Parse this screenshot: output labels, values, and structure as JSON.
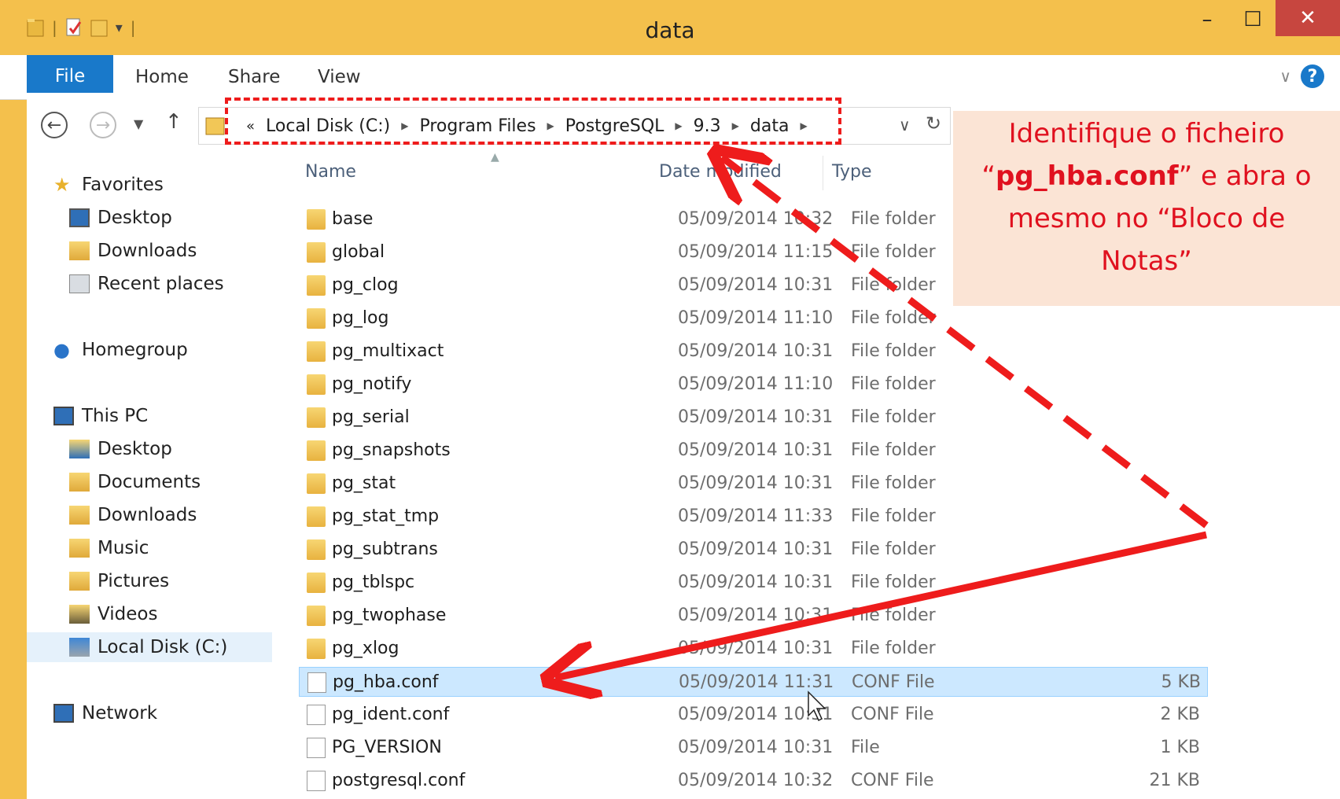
{
  "window": {
    "title": "data",
    "minimize": "–",
    "maximize": "☐",
    "close": "✕"
  },
  "ribbon": {
    "tabs": [
      "File",
      "Home",
      "Share",
      "View"
    ],
    "help": "?"
  },
  "address": {
    "overflow": "«",
    "crumbs": [
      "Local Disk (C:)",
      "Program Files",
      "PostgreSQL",
      "9.3",
      "data"
    ],
    "dropdown": "∨"
  },
  "sidebar": {
    "favorites": "Favorites",
    "fav_items": [
      "Desktop",
      "Downloads",
      "Recent places"
    ],
    "homegroup": "Homegroup",
    "thispc": "This PC",
    "pc_items": [
      "Desktop",
      "Documents",
      "Downloads",
      "Music",
      "Pictures",
      "Videos",
      "Local Disk (C:)"
    ],
    "network": "Network"
  },
  "columns": {
    "name": "Name",
    "date": "Date modified",
    "type": "Type"
  },
  "files": [
    {
      "name": "base",
      "date": "05/09/2014 10:32",
      "type": "File folder",
      "size": "",
      "icon": "folder-icon"
    },
    {
      "name": "global",
      "date": "05/09/2014 11:15",
      "type": "File folder",
      "size": "",
      "icon": "folder-icon"
    },
    {
      "name": "pg_clog",
      "date": "05/09/2014 10:31",
      "type": "File folder",
      "size": "",
      "icon": "folder-icon"
    },
    {
      "name": "pg_log",
      "date": "05/09/2014 11:10",
      "type": "File folder",
      "size": "",
      "icon": "folder-icon"
    },
    {
      "name": "pg_multixact",
      "date": "05/09/2014 10:31",
      "type": "File folder",
      "size": "",
      "icon": "folder-icon"
    },
    {
      "name": "pg_notify",
      "date": "05/09/2014 11:10",
      "type": "File folder",
      "size": "",
      "icon": "folder-icon"
    },
    {
      "name": "pg_serial",
      "date": "05/09/2014 10:31",
      "type": "File folder",
      "size": "",
      "icon": "folder-icon"
    },
    {
      "name": "pg_snapshots",
      "date": "05/09/2014 10:31",
      "type": "File folder",
      "size": "",
      "icon": "folder-icon"
    },
    {
      "name": "pg_stat",
      "date": "05/09/2014 10:31",
      "type": "File folder",
      "size": "",
      "icon": "folder-icon"
    },
    {
      "name": "pg_stat_tmp",
      "date": "05/09/2014 11:33",
      "type": "File folder",
      "size": "",
      "icon": "folder-icon"
    },
    {
      "name": "pg_subtrans",
      "date": "05/09/2014 10:31",
      "type": "File folder",
      "size": "",
      "icon": "folder-icon"
    },
    {
      "name": "pg_tblspc",
      "date": "05/09/2014 10:31",
      "type": "File folder",
      "size": "",
      "icon": "folder-icon"
    },
    {
      "name": "pg_twophase",
      "date": "05/09/2014 10:31",
      "type": "File folder",
      "size": "",
      "icon": "folder-icon"
    },
    {
      "name": "pg_xlog",
      "date": "05/09/2014 10:31",
      "type": "File folder",
      "size": "",
      "icon": "folder-icon"
    },
    {
      "name": "pg_hba.conf",
      "date": "05/09/2014 11:31",
      "type": "CONF File",
      "size": "5 KB",
      "icon": "file-icon",
      "selected": true
    },
    {
      "name": "pg_ident.conf",
      "date": "05/09/2014 10:31",
      "type": "CONF File",
      "size": "2 KB",
      "icon": "file-icon"
    },
    {
      "name": "PG_VERSION",
      "date": "05/09/2014 10:31",
      "type": "File",
      "size": "1 KB",
      "icon": "file-icon"
    },
    {
      "name": "postgresql.conf",
      "date": "05/09/2014 10:32",
      "type": "CONF File",
      "size": "21 KB",
      "icon": "file-icon"
    }
  ],
  "callout": {
    "line1": "Identifique o ficheiro",
    "line2_pre": "“",
    "line2_bold": "pg_hba.conf",
    "line2_post": "” e abra o",
    "line3": "mesmo no “Bloco de",
    "line4": "Notas”"
  },
  "colors": {
    "titlebar": "#f4c04c",
    "accent": "#1979ca",
    "annotation": "#ee1c1c",
    "callout_bg": "#fbe4d5"
  }
}
